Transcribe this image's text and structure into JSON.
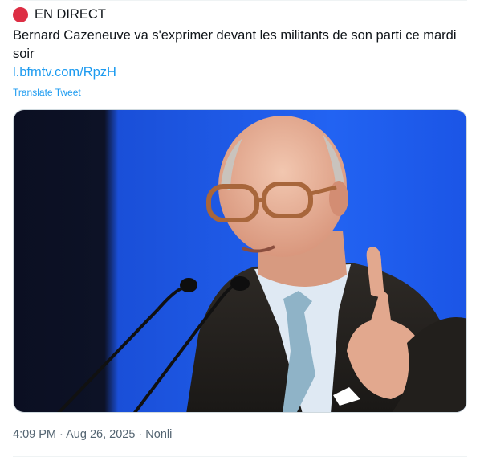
{
  "tweet": {
    "live_label": "EN DIRECT",
    "text": "Bernard Cazeneuve va s'exprimer devant les militants de son parti ce mardi soir",
    "link": "l.bfmtv.com/RpzH",
    "translate_label": "Translate Tweet",
    "media_subject": "photo",
    "meta": {
      "time": "4:09 PM",
      "separator": "·",
      "date": "Aug 26, 2025",
      "source": "Nonli"
    }
  },
  "colors": {
    "text": "#0f1419",
    "link": "#1d9bf0",
    "secondary": "#536471",
    "live_dot": "#dd2e44",
    "photo_background": "#1f5ff0"
  },
  "icons": {
    "live": "red-circle-icon"
  }
}
